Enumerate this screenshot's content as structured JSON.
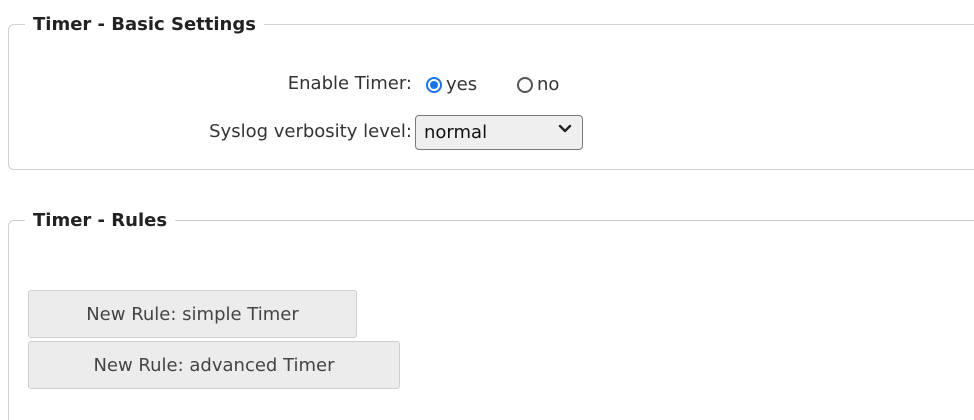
{
  "basic_settings": {
    "legend": "Timer - Basic Settings",
    "enable_label": "Enable Timer:",
    "radio_yes": "yes",
    "radio_no": "no",
    "selected": "yes",
    "syslog_label": "Syslog verbosity level:",
    "syslog_value": "normal"
  },
  "rules": {
    "legend": "Timer - Rules",
    "btn_simple": "New Rule: simple Timer",
    "btn_advanced": "New Rule: advanced Timer"
  },
  "colors": {
    "accent": "#1a73e8"
  },
  "icons": {
    "dropdown": "chevron-down-icon"
  }
}
